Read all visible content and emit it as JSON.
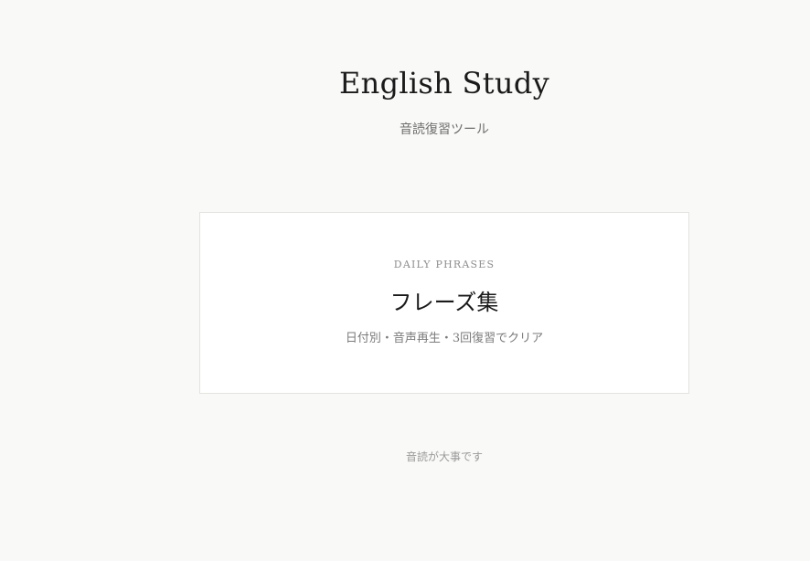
{
  "header": {
    "title": "English Study",
    "subtitle": "音読復習ツール"
  },
  "card": {
    "eyebrow": "DAILY PHRASES",
    "title": "フレーズ集",
    "description": "日付別・音声再生・3回復習でクリア"
  },
  "footer": {
    "note": "音読が大事です"
  },
  "colors": {
    "background": "#f9f9f7",
    "card_background": "#ffffff",
    "card_border": "#e3e3e0",
    "title_text": "#1a1a1a",
    "muted_text": "#7a7a7a"
  }
}
